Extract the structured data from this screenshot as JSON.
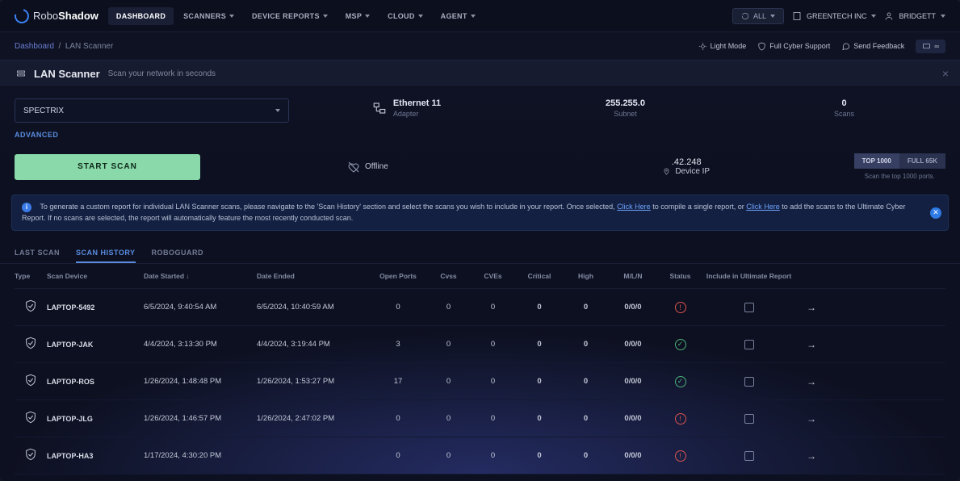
{
  "brand": {
    "name1": "Robo",
    "name2": "Shadow"
  },
  "nav": {
    "items": [
      "DASHBOARD",
      "SCANNERS",
      "DEVICE REPORTS",
      "MSP",
      "CLOUD",
      "AGENT"
    ],
    "allBtn": "ALL",
    "org": "GREENTECH INC",
    "user": "BRIDGETT"
  },
  "breadcrumb": {
    "root": "Dashboard",
    "current": "LAN Scanner"
  },
  "subhead": {
    "lightMode": "Light Mode",
    "support": "Full Cyber Support",
    "feedback": "Send Feedback"
  },
  "page": {
    "title": "LAN Scanner",
    "subtitle": "Scan your network in seconds"
  },
  "config": {
    "device": "SPECTRIX",
    "advanced": "ADVANCED",
    "adapter": {
      "value": "Ethernet 11",
      "label": "Adapter"
    },
    "subnet": {
      "value": "255.255.0",
      "label": "Subnet"
    },
    "scans": {
      "value": "0",
      "label": "Scans"
    },
    "startBtn": "START SCAN",
    "offline": "Offline",
    "ip": {
      "value": ".42.248",
      "label": "Device IP"
    },
    "port1000": "TOP 1000",
    "port65k": "FULL 65K",
    "portHelp": "Scan the top 1000 ports."
  },
  "banner": {
    "text1": "To generate a custom report for individual LAN Scanner scans, please navigate to the 'Scan History' section and select the scans you wish to include in your report. Once selected, ",
    "link1": "Click Here",
    "text2": " to compile a single report, or ",
    "link2": "Click Here",
    "text3": " to add the scans to the Ultimate Cyber Report. If no scans are selected, the report will automatically feature the most recently conducted scan."
  },
  "tabs": [
    "LAST SCAN",
    "SCAN HISTORY",
    "ROBOGUARD"
  ],
  "columns": [
    "Type",
    "Scan Device",
    "Date Started",
    "Date Ended",
    "Open Ports",
    "Cvss",
    "CVEs",
    "Critical",
    "High",
    "M/L/N",
    "Status",
    "Include in Ultimate Report",
    ""
  ],
  "rows": [
    {
      "device": "LAPTOP-5492",
      "started": "6/5/2024, 9:40:54 AM",
      "ended": "6/5/2024, 10:40:59 AM",
      "ports": "0",
      "cvss": "0",
      "cves": "0",
      "crit": "0",
      "high": "0",
      "mln": "0/0/0",
      "status": "warn"
    },
    {
      "device": "LAPTOP-JAK",
      "started": "4/4/2024, 3:13:30 PM",
      "ended": "4/4/2024, 3:19:44 PM",
      "ports": "3",
      "cvss": "0",
      "cves": "0",
      "crit": "0",
      "high": "0",
      "mln": "0/0/0",
      "status": "ok"
    },
    {
      "device": "LAPTOP-ROS",
      "started": "1/26/2024, 1:48:48 PM",
      "ended": "1/26/2024, 1:53:27 PM",
      "ports": "17",
      "cvss": "0",
      "cves": "0",
      "crit": "0",
      "high": "0",
      "mln": "0/0/0",
      "status": "ok"
    },
    {
      "device": "LAPTOP-JLG",
      "started": "1/26/2024, 1:46:57 PM",
      "ended": "1/26/2024, 2:47:02 PM",
      "ports": "0",
      "cvss": "0",
      "cves": "0",
      "crit": "0",
      "high": "0",
      "mln": "0/0/0",
      "status": "warn"
    },
    {
      "device": "LAPTOP-HA3",
      "started": "1/17/2024, 4:30:20 PM",
      "ended": "",
      "ports": "0",
      "cvss": "0",
      "cves": "0",
      "crit": "0",
      "high": "0",
      "mln": "0/0/0",
      "status": "warn"
    }
  ]
}
